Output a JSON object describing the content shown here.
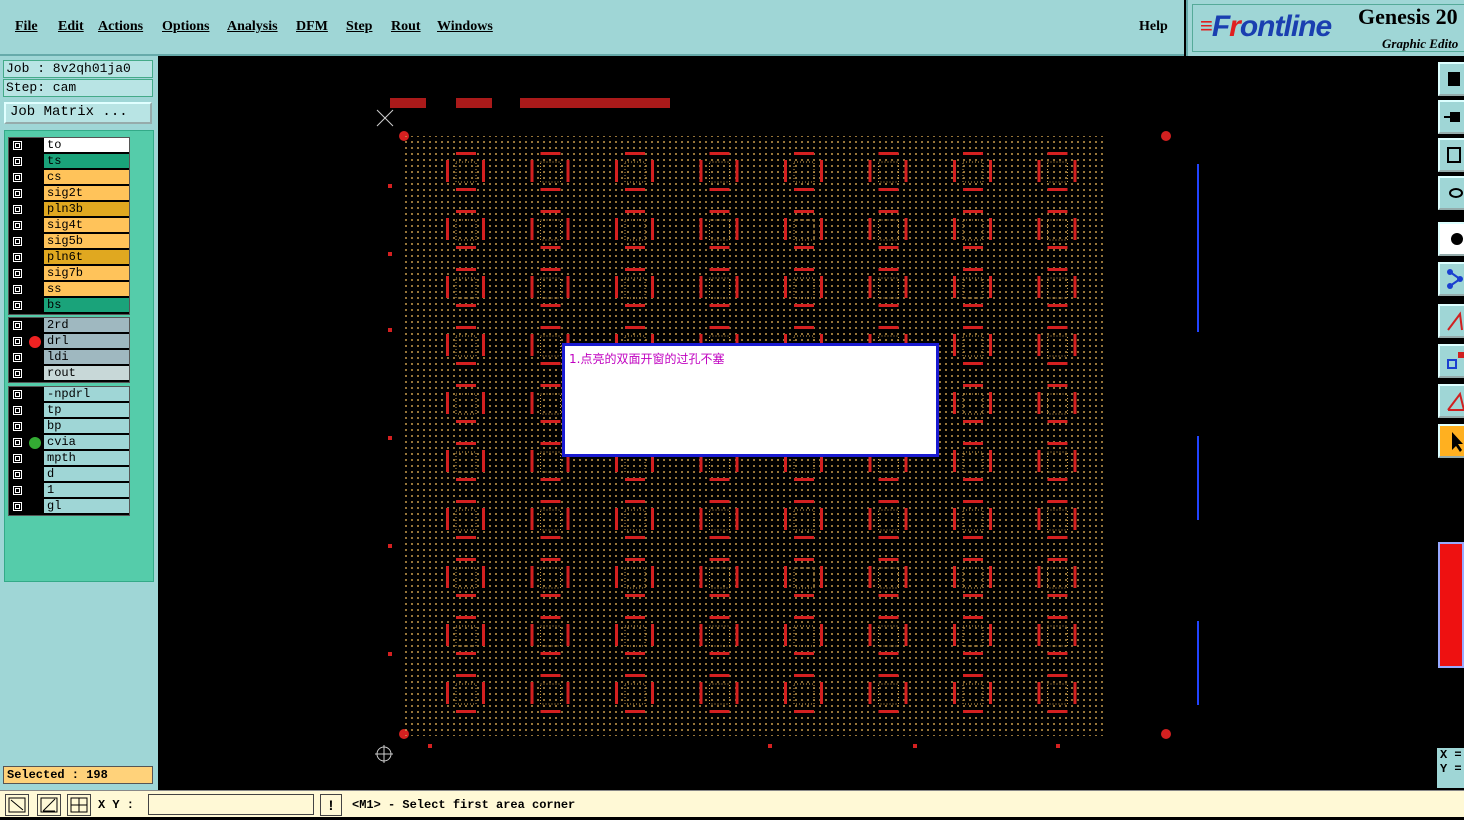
{
  "menu": {
    "items": [
      "File",
      "Edit",
      "Actions",
      "Options",
      "Analysis",
      "DFM",
      "Step",
      "Rout",
      "Windows"
    ],
    "help": "Help"
  },
  "brand": {
    "logo_pre": "F",
    "logo_red": "r",
    "logo_post": "ontline",
    "title": "Genesis 20",
    "subtitle": "Graphic Edito"
  },
  "job": {
    "job_label": "Job : 8v2qh01ja0",
    "step_label": "Step: cam",
    "matrix_button": "Job Matrix ..."
  },
  "layers": {
    "board": [
      {
        "name": "to",
        "color": "#ffffff"
      },
      {
        "name": "ts",
        "color": "#1aa37a"
      },
      {
        "name": "cs",
        "color": "#ffc35a"
      },
      {
        "name": "sig2t",
        "color": "#ffc35a"
      },
      {
        "name": "pln3b",
        "color": "#e0a820"
      },
      {
        "name": "sig4t",
        "color": "#ffc35a"
      },
      {
        "name": "sig5b",
        "color": "#ffc35a"
      },
      {
        "name": "pln6t",
        "color": "#e0a820"
      },
      {
        "name": "sig7b",
        "color": "#ffc35a"
      },
      {
        "name": "ss",
        "color": "#ffc35a"
      },
      {
        "name": "bs",
        "color": "#1aa37a"
      }
    ],
    "drill": [
      {
        "name": "2rd",
        "color": "#9fb8c0"
      },
      {
        "name": "drl",
        "color": "#9fb8c0",
        "marker": "#ee2222"
      },
      {
        "name": "ldi",
        "color": "#9fb8c0"
      },
      {
        "name": "rout",
        "color": "#c8d8d8"
      }
    ],
    "misc": [
      {
        "name": "-npdrl",
        "color": "#9fd6d6"
      },
      {
        "name": "tp",
        "color": "#9fd6d6"
      },
      {
        "name": "bp",
        "color": "#9fd6d6"
      },
      {
        "name": "cvia",
        "color": "#9fd6d6",
        "marker": "#33aa33"
      },
      {
        "name": "mpth",
        "color": "#9fd6d6"
      },
      {
        "name": "d",
        "color": "#9fd6d6"
      },
      {
        "name": "1",
        "color": "#9fd6d6"
      },
      {
        "name": "gl",
        "color": "#9fd6d6"
      }
    ]
  },
  "selected": "Selected : 198",
  "note": {
    "text": "1.点亮的双面开窗的过孔不塞"
  },
  "right_coords": {
    "x": "X =",
    "y": "Y ="
  },
  "status": {
    "xy_label": "X Y :",
    "xy_value": "",
    "warn": "!",
    "prompt": "<M1> - Select first area corner"
  },
  "colors": {
    "panel": "#9fd6d6",
    "layer_panel": "#55ccaa",
    "pad_red": "#d42020",
    "trace_orange": "#c89a4a"
  }
}
